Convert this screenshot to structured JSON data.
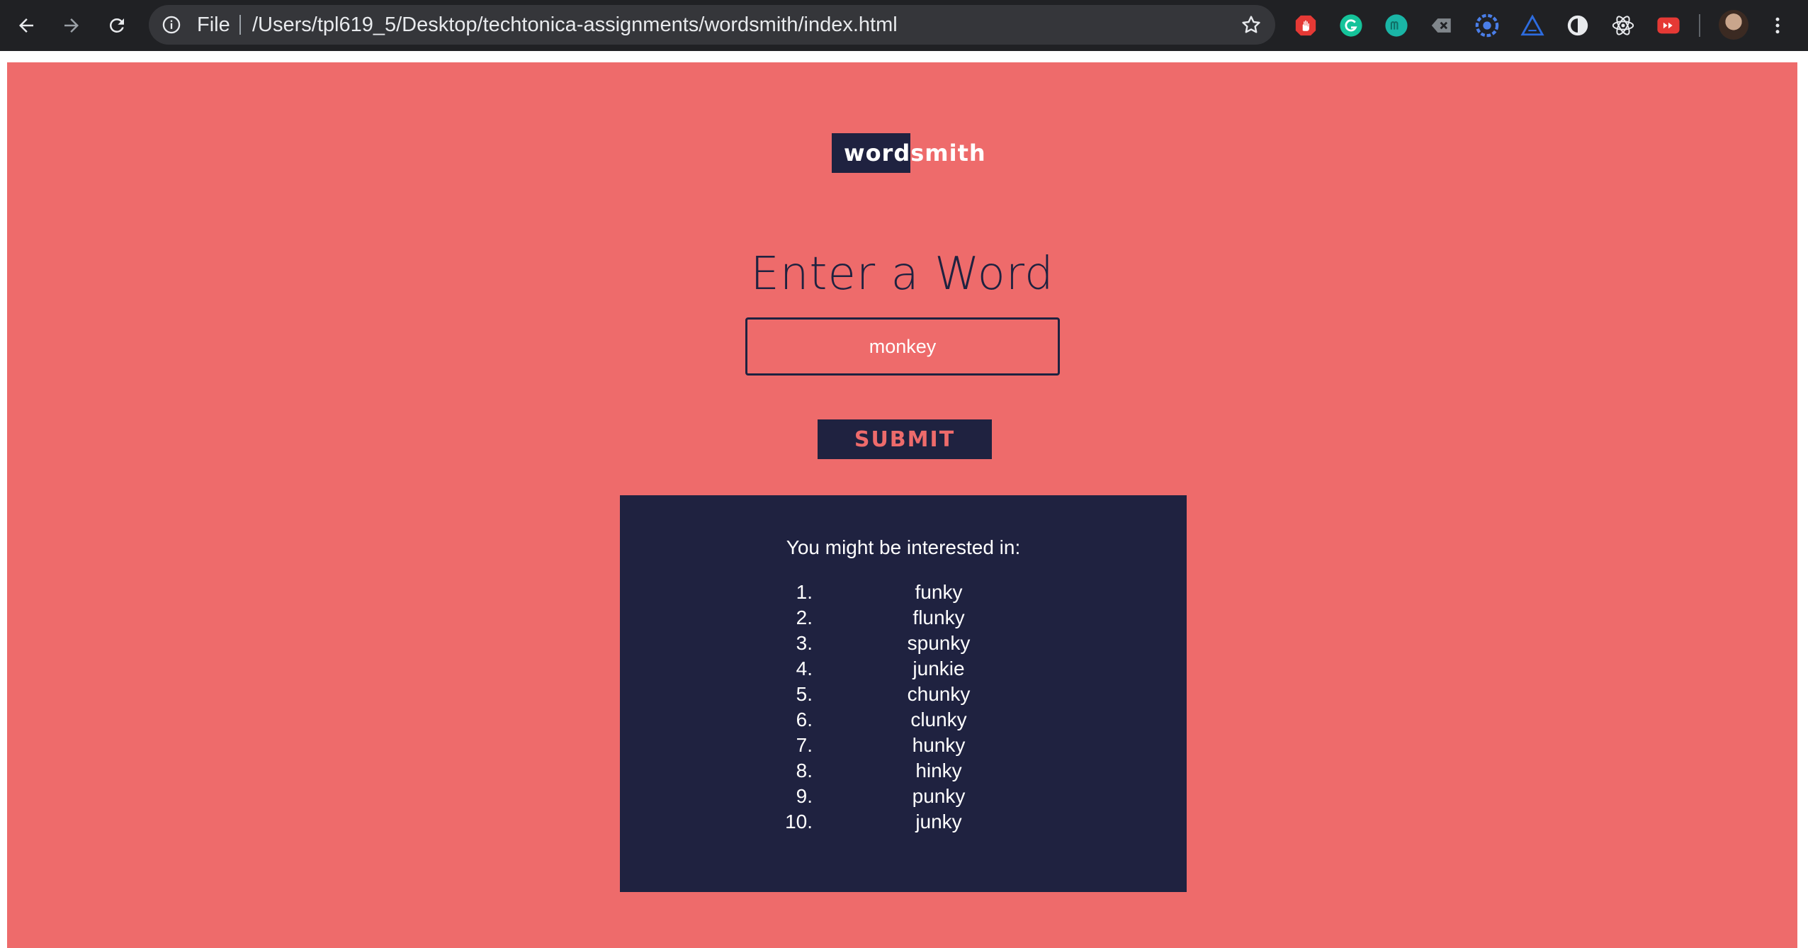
{
  "browser": {
    "scheme_label": "File",
    "url": "/Users/tpl619_5/Desktop/techtonica-assignments/wordsmith/index.html",
    "extensions": [
      "stop-hand-extension",
      "grammarly-extension",
      "mercury-extension",
      "clear-cache-extension",
      "chromium-extension",
      "vercel-extension",
      "dark-reader-extension",
      "react-devtools-extension",
      "youtube-extension"
    ]
  },
  "page": {
    "background_color": "#ee6b6b",
    "accent_color": "#1f2240",
    "logo": {
      "highlighted": "word",
      "rest": "smith"
    },
    "heading": "Enter a Word",
    "input": {
      "value": "monkey"
    },
    "submit_label": "SUBMIT",
    "results": {
      "title": "You might be interested in:",
      "items": [
        {
          "num": "1.",
          "word": "funky"
        },
        {
          "num": "2.",
          "word": "flunky"
        },
        {
          "num": "3.",
          "word": "spunky"
        },
        {
          "num": "4.",
          "word": "junkie"
        },
        {
          "num": "5.",
          "word": "chunky"
        },
        {
          "num": "6.",
          "word": "clunky"
        },
        {
          "num": "7.",
          "word": "hunky"
        },
        {
          "num": "8.",
          "word": "hinky"
        },
        {
          "num": "9.",
          "word": "punky"
        },
        {
          "num": "10.",
          "word": "junky"
        }
      ]
    }
  }
}
